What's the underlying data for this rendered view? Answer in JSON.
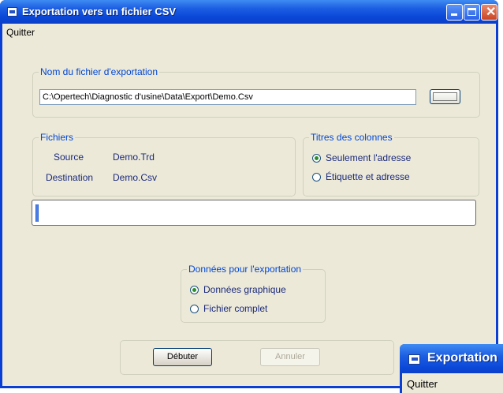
{
  "window": {
    "title": "Exportation vers un fichier CSV"
  },
  "menu": {
    "quit": "Quitter"
  },
  "export_file": {
    "legend": "Nom du fichier d'exportation",
    "path": "C:\\Opertech\\Diagnostic d'usine\\Data\\Export\\Demo.Csv"
  },
  "files": {
    "legend": "Fichiers",
    "source_label": "Source",
    "source_value": "Demo.Trd",
    "destination_label": "Destination",
    "destination_value": "Demo.Csv"
  },
  "column_titles": {
    "legend": "Titres des colonnes",
    "options": [
      "Seulement l'adresse",
      "Étiquette et adresse"
    ],
    "selected": 0
  },
  "progress": {
    "fraction": 0.01
  },
  "export_data": {
    "legend": "Données pour l'exportation",
    "options": [
      "Données graphique",
      "Fichier complet"
    ],
    "selected": 0
  },
  "buttons": {
    "start": "Débuter",
    "cancel": "Annuler"
  },
  "mini_window": {
    "title": "Exportation",
    "menu": "Quitter"
  },
  "colors": {
    "titlebar": "#0b48d8",
    "legend_text": "#0046d5",
    "face": "#ece9d8"
  }
}
